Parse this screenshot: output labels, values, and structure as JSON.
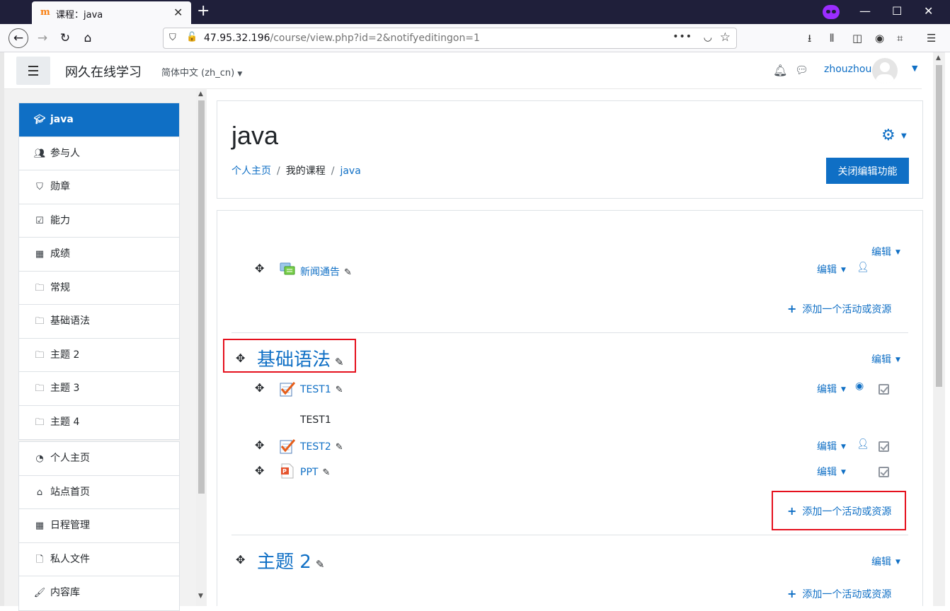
{
  "browser": {
    "tab_title": "课程：java",
    "tab_favicon": "moodle-favicon",
    "url_host": "47.95.32.196",
    "url_path": "/course/view.php?id=2&notifyeditingon=1"
  },
  "header": {
    "site_name": "网久在线学习",
    "language": "简体中文 (zh_cn)",
    "username": "zhouzhou"
  },
  "drawer": {
    "course_items": [
      {
        "label": "java",
        "icon": "graduation-cap-icon"
      },
      {
        "label": "参与人",
        "icon": "users-icon"
      },
      {
        "label": "勋章",
        "icon": "shield-icon"
      },
      {
        "label": "能力",
        "icon": "check-square-icon"
      },
      {
        "label": "成绩",
        "icon": "table-icon"
      },
      {
        "label": "常规",
        "icon": "folder-icon"
      },
      {
        "label": "基础语法",
        "icon": "folder-icon"
      },
      {
        "label": "主题 2",
        "icon": "folder-icon"
      },
      {
        "label": "主题 3",
        "icon": "folder-icon"
      },
      {
        "label": "主题 4",
        "icon": "folder-icon"
      }
    ],
    "site_items": [
      {
        "label": "个人主页",
        "icon": "dashboard-icon"
      },
      {
        "label": "站点首页",
        "icon": "home-icon"
      },
      {
        "label": "日程管理",
        "icon": "calendar-icon"
      },
      {
        "label": "私人文件",
        "icon": "file-icon"
      },
      {
        "label": "内容库",
        "icon": "paint-brush-icon"
      }
    ]
  },
  "page": {
    "course_title": "java",
    "breadcrumb": {
      "home": "个人主页",
      "my_courses": "我的课程",
      "course": "java"
    },
    "edit_toggle_label": "关闭编辑功能"
  },
  "sections": {
    "edit_label": "编辑",
    "add_label": "添加一个活动或资源",
    "general": {
      "activities": [
        {
          "name": "新闻通告",
          "icon": "forum-icon"
        }
      ]
    },
    "s1": {
      "title": "基础语法",
      "activities": [
        {
          "name": "TEST1",
          "icon": "quiz-icon",
          "description": "TEST1"
        },
        {
          "name": "TEST2",
          "icon": "quiz-icon"
        },
        {
          "name": "PPT",
          "icon": "powerpoint-file-icon"
        }
      ]
    },
    "s2": {
      "title": "主题 2"
    }
  },
  "colors": {
    "accent": "#0f6fc5",
    "highlight_box": "#e5101d"
  }
}
